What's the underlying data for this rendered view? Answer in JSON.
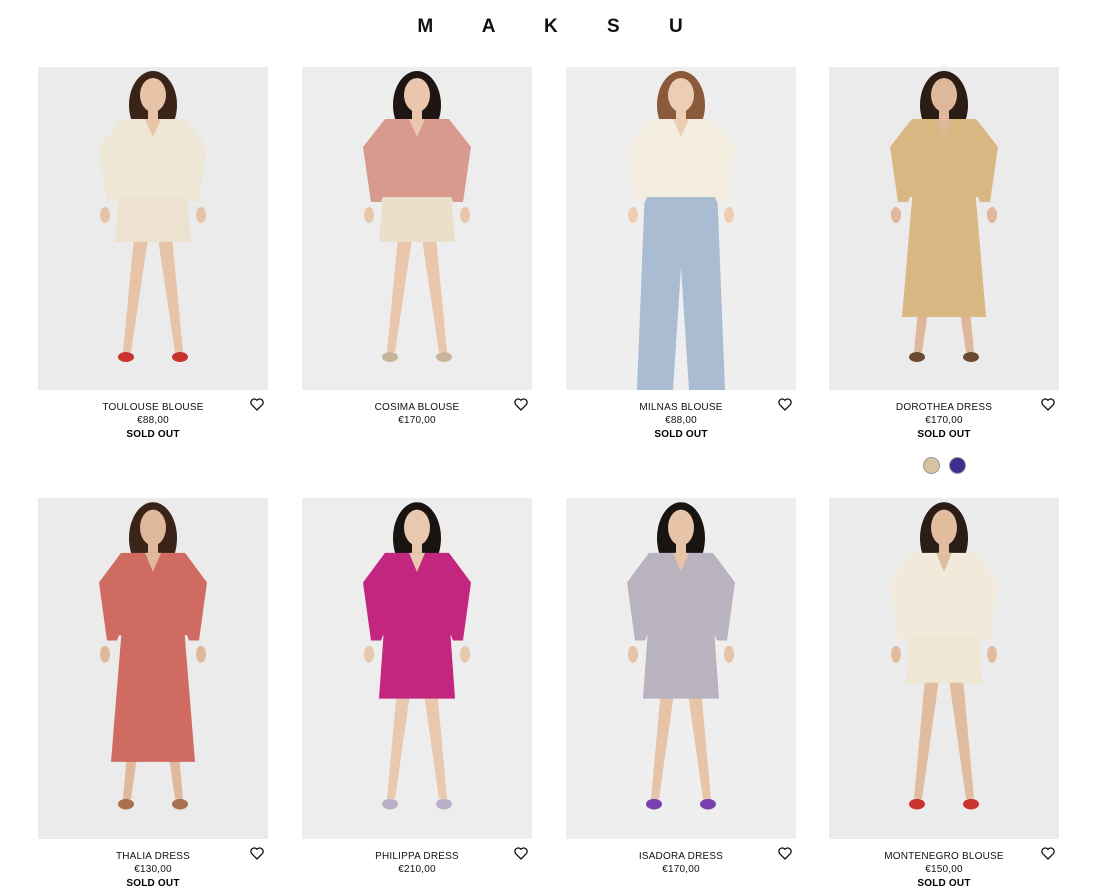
{
  "brand": "M A K S U",
  "products": [
    {
      "name": "TOULOUSE BLOUSE",
      "price": "€88,00",
      "status": "SOLD OUT",
      "photo": {
        "skin": "#e7c3a8",
        "hair": "#3a2418",
        "top": "#efe7d6",
        "bottom": "#ece2cf",
        "shoes": "#c8342b",
        "bg": "#ebebeb",
        "length": "shorts"
      }
    },
    {
      "name": "COSIMA BLOUSE",
      "price": "€170,00",
      "status": "",
      "photo": {
        "skin": "#e9c6ac",
        "hair": "#1e1612",
        "top": "#d89a8e",
        "bottom": "#eadfcb",
        "shoes": "#c8b49a",
        "bg": "#ededed",
        "length": "shorts"
      }
    },
    {
      "name": "MILNAS BLOUSE",
      "price": "€88,00",
      "status": "SOLD OUT",
      "photo": {
        "skin": "#edcdb3",
        "hair": "#8a5a3a",
        "top": "#f3eedf",
        "bottom": "#a9bcd2",
        "shoes": "#a9bcd2",
        "bg": "#eeeeee",
        "length": "trousers"
      }
    },
    {
      "name": "DOROTHEA DRESS",
      "price": "€170,00",
      "status": "SOLD OUT",
      "swatches": [
        "#d8c2a0",
        "#3b2f8f"
      ],
      "photo": {
        "skin": "#dfb79a",
        "hair": "#2b1c14",
        "top": "#d9b782",
        "bottom": "#d9b782",
        "shoes": "#6a4a32",
        "bg": "#ebebeb",
        "length": "midi"
      }
    },
    {
      "name": "THALIA DRESS",
      "price": "€130,00",
      "status": "SOLD OUT",
      "photo": {
        "skin": "#e0b89b",
        "hair": "#3a2418",
        "top": "#cf6b61",
        "bottom": "#cf6b61",
        "shoes": "#a8714e",
        "bg": "#ebebeb",
        "length": "midi"
      }
    },
    {
      "name": "PHILIPPA DRESS",
      "price": "€210,00",
      "status": "",
      "photo": {
        "skin": "#e8c8ae",
        "hair": "#1a1411",
        "top": "#c3267f",
        "bottom": "#c3267f",
        "shoes": "#b8b0c8",
        "bg": "#ededed",
        "length": "mini"
      }
    },
    {
      "name": "ISADORA DRESS",
      "price": "€170,00",
      "status": "",
      "photo": {
        "skin": "#e7c4a8",
        "hair": "#1a1411",
        "top": "#b9b2bf",
        "bottom": "#b9b2bf",
        "shoes": "#7a3fb0",
        "bg": "#eeeeee",
        "length": "mini"
      }
    },
    {
      "name": "MONTENEGRO BLOUSE",
      "price": "€150,00",
      "status": "SOLD OUT",
      "photo": {
        "skin": "#e2bc9f",
        "hair": "#2a1d17",
        "top": "#f1eadb",
        "bottom": "#efe6d3",
        "shoes": "#c8342b",
        "bg": "#ebebeb",
        "length": "shorts"
      }
    }
  ]
}
